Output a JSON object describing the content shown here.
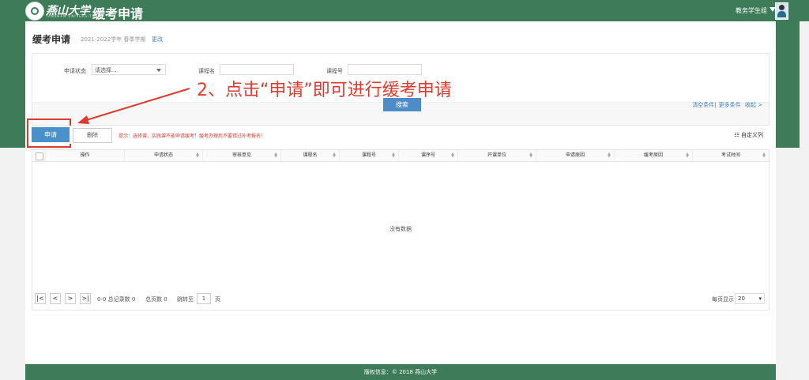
{
  "header": {
    "brand": "燕山大学",
    "brand_sub": "YANSHAN UNIVERSITY",
    "app_title": "缓考申请",
    "user": "教务学生组"
  },
  "page": {
    "title": "缓考申请",
    "semester": "2021-2022学年 春季学期",
    "change": "更改"
  },
  "filters": {
    "status_label": "申请状态",
    "status_value": "请选择...",
    "course_name_label": "课程名",
    "course_no_label": "课程号",
    "search": "搜索",
    "clear": "清空条件",
    "more": "更多条件",
    "collapse": "收起 >"
  },
  "annotation": "2、点击“申请”即可进行缓考申请",
  "toolbar": {
    "apply": "申请",
    "delete": "删除",
    "tip": "提示：选修课、实践课不能申请缓考！缓考办理后不要错过补考报名！",
    "custom_columns": "自定义列"
  },
  "table": {
    "columns": [
      "操作",
      "申请状态",
      "审核意见",
      "课程名",
      "课程号",
      "课序号",
      "开课单位",
      "申请原因",
      "缓考原因",
      "考试时间"
    ],
    "empty": "没有数据"
  },
  "pager": {
    "summary": "0-0 总记录数 0",
    "pages": "总页数 0",
    "goto": "跳转至",
    "page_value": "1",
    "page_unit": "页",
    "per_page_label": "每页显示",
    "per_page_value": "20"
  },
  "footer": {
    "text": "版权信息：© 2018 燕山大学"
  },
  "colors": {
    "brand_green": "#3e7b58",
    "accent_blue": "#4a90c9",
    "alert_red": "#e03a2c"
  }
}
